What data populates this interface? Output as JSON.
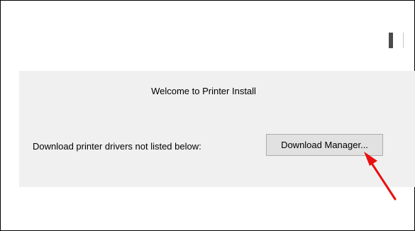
{
  "dialog": {
    "welcome_text": "Welcome to Printer Install",
    "download_prompt": "Download printer drivers not listed below:",
    "download_button_label": "Download Manager..."
  },
  "annotation": {
    "arrow_color": "#e81010",
    "icon": "red-arrow-icon"
  },
  "colors": {
    "panel_background": "#f0f0f0",
    "button_background": "#e1e1e1",
    "button_border": "#adadad"
  }
}
